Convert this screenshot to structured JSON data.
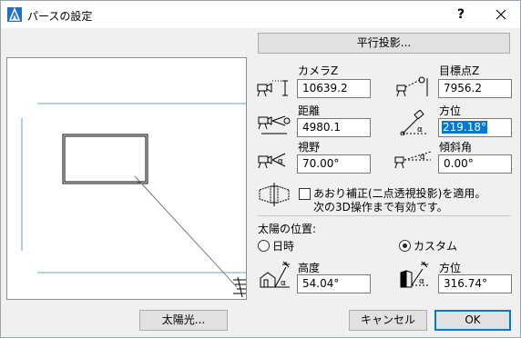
{
  "window": {
    "title": "パースの設定",
    "help_label": "?"
  },
  "buttons": {
    "parallel": "平行投影...",
    "sunlight": "太陽光...",
    "cancel": "キャンセル",
    "ok": "OK"
  },
  "camera": {
    "camera_z_label": "カメラZ",
    "camera_z_value": "10639.2",
    "target_z_label": "目標点Z",
    "target_z_value": "7956.2",
    "distance_label": "距離",
    "distance_value": "4980.1",
    "azimuth_label": "方位",
    "azimuth_value": "219.18°",
    "fov_label": "視野",
    "fov_value": "70.00°",
    "roll_label": "傾斜角",
    "roll_value": "0.00°"
  },
  "correction": {
    "line1": "あおり補正(二点透視投影)を適用。",
    "line2": "次の3D操作まで有効です。"
  },
  "sun": {
    "section_label": "太陽の位置:",
    "datetime_label": "日時",
    "custom_label": "カスタム",
    "altitude_label": "高度",
    "altitude_value": "54.04°",
    "azimuth_label": "方位",
    "azimuth_value": "316.74°"
  },
  "icons": {
    "app": "archicad-logo-icon",
    "close": "close-icon"
  },
  "colors": {
    "accent": "#0078d7",
    "guide_line": "#5fa0d8"
  }
}
